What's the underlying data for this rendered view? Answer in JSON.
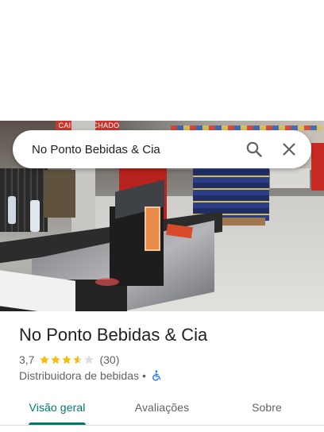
{
  "search": {
    "query": "No Ponto Bebidas & Cia",
    "search_icon": "search-icon",
    "close_icon": "close-icon"
  },
  "photo": {
    "sign_text": "CAIXA FECHADO"
  },
  "place": {
    "name": "No Ponto Bebidas & Cia",
    "rating": "3,7",
    "rating_value": 3.7,
    "review_count": "(30)",
    "category": "Distribuidora de bebidas",
    "separator": "•",
    "accessibility_icon": "wheelchair-icon"
  },
  "tabs": [
    {
      "label": "Visão geral",
      "active": true
    },
    {
      "label": "Avaliações",
      "active": false
    },
    {
      "label": "Sobre",
      "active": false
    }
  ],
  "colors": {
    "accent": "#00796b",
    "star": "#fbbc04",
    "star_empty": "#dadce0",
    "accessibility": "#1a73e8"
  }
}
